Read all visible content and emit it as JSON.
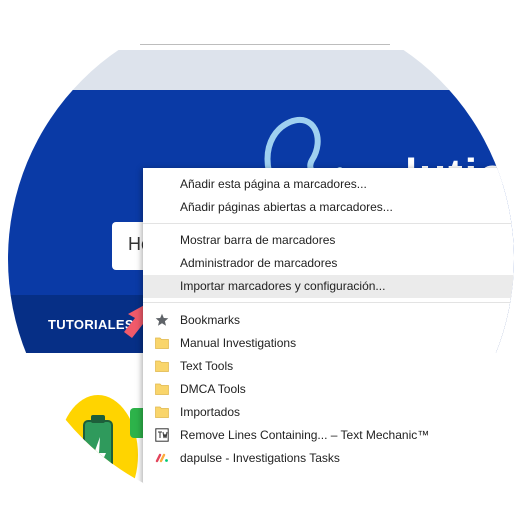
{
  "website": {
    "search_placeholder": "Ho",
    "nav_item": "TUTORIALES",
    "logo_text": "lutio"
  },
  "menu": {
    "section_add": [
      "Añadir esta página a marcadores...",
      "Añadir páginas abiertas a marcadores..."
    ],
    "section_manage": [
      "Mostrar barra de marcadores",
      "Administrador de marcadores",
      "Importar marcadores y configuración..."
    ],
    "bookmarks": [
      {
        "label": "Bookmarks",
        "icon": "star-icon"
      },
      {
        "label": "Manual Investigations",
        "icon": "folder-icon"
      },
      {
        "label": "Text Tools",
        "icon": "folder-icon"
      },
      {
        "label": "DMCA Tools",
        "icon": "folder-icon"
      },
      {
        "label": "Importados",
        "icon": "folder-icon"
      },
      {
        "label": "Remove Lines Containing... – Text Mechanic™",
        "icon": "text-mechanic-icon"
      },
      {
        "label": "dapulse - Investigations Tasks",
        "icon": "dapulse-icon"
      }
    ],
    "highlighted_item": "Importar marcadores y configuración..."
  },
  "colors": {
    "hero": "#0a3aa6",
    "navbar": "#062f86",
    "arrow": "#f05a6a",
    "folder": "#f9d56b",
    "highlight": "#ebebeb"
  }
}
